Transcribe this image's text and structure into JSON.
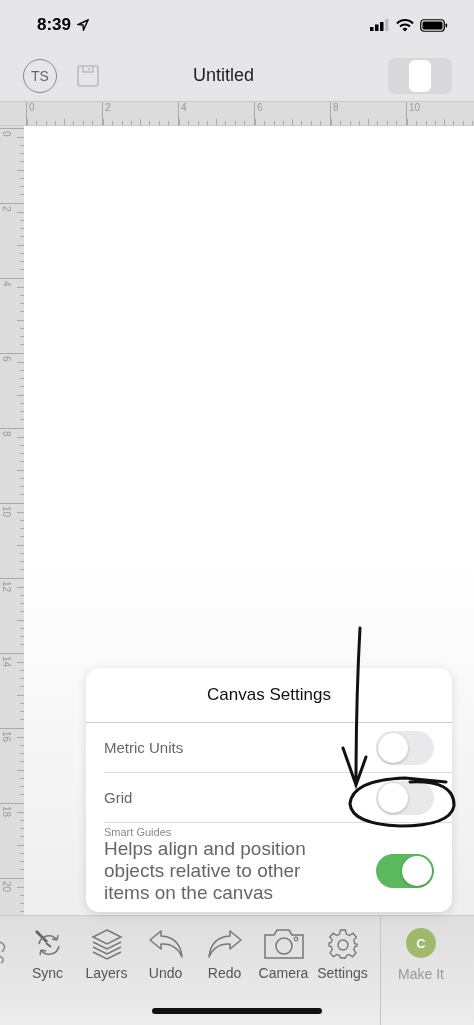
{
  "status_bar": {
    "time": "8:39"
  },
  "header": {
    "avatar": "TS",
    "title": "Untitled",
    "view_toggle": {
      "on": true
    }
  },
  "rulers": {
    "horizontal": [
      "0",
      "2",
      "4",
      "6",
      "8",
      "10"
    ],
    "vertical": [
      "0",
      "2",
      "4",
      "6",
      "8",
      "10",
      "12",
      "14",
      "16",
      "18",
      "20"
    ]
  },
  "popover": {
    "title": "Canvas Settings",
    "settings": [
      {
        "kind": "toggle",
        "label": "Metric Units",
        "on": false
      },
      {
        "kind": "toggle",
        "label": "Grid",
        "on": false
      },
      {
        "kind": "described",
        "label": "Smart Guides",
        "description": "Helps align and position objects relative to other items on the canvas",
        "on": true
      }
    ]
  },
  "toolbar": {
    "items": [
      {
        "kind": "sync",
        "label": "Sync"
      },
      {
        "kind": "layers",
        "label": "Layers"
      },
      {
        "kind": "undo",
        "label": "Undo"
      },
      {
        "kind": "redo",
        "label": "Redo"
      },
      {
        "kind": "camera",
        "label": "Camera"
      },
      {
        "kind": "settings",
        "label": "Settings"
      }
    ],
    "make_it": {
      "badge": "C",
      "label": "Make It",
      "disabled": true
    }
  }
}
